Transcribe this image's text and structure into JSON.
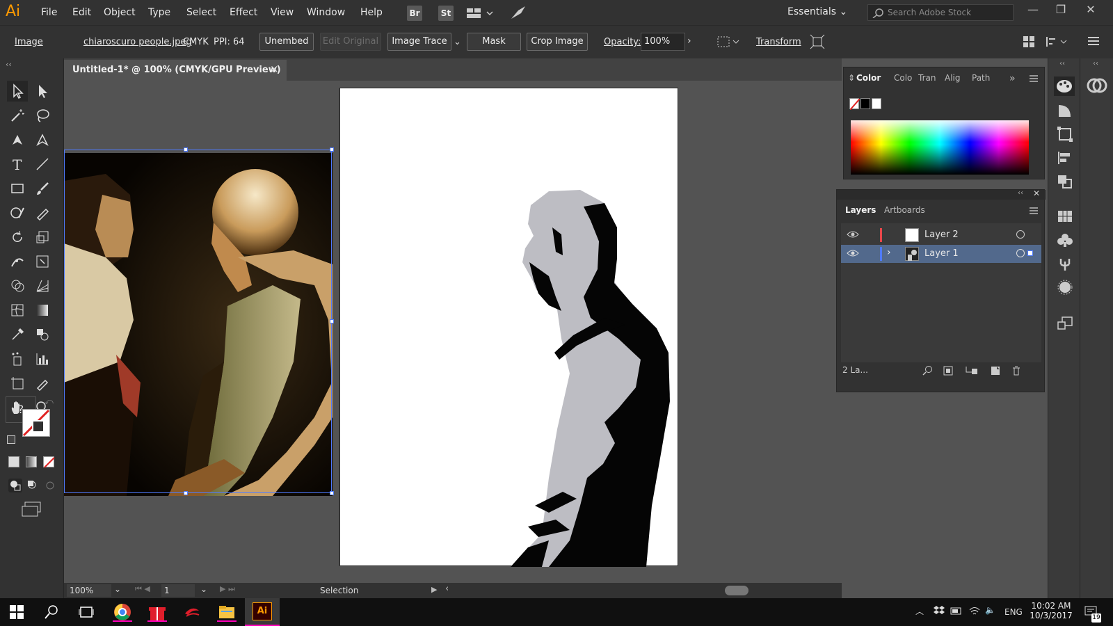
{
  "app": {
    "logo": "Ai"
  },
  "menu": [
    "File",
    "Edit",
    "Object",
    "Type",
    "Select",
    "Effect",
    "View",
    "Window",
    "Help"
  ],
  "bridge_buttons": [
    "Br",
    "St"
  ],
  "workspace": "Essentials",
  "search": {
    "placeholder": "Search Adobe Stock"
  },
  "control_bar": {
    "type_label": "Image",
    "file_name": "chiaroscuro people.jpeg",
    "color_mode": "CMYK",
    "ppi": "PPI: 64",
    "unembed": "Unembed",
    "edit_original": "Edit Original",
    "image_trace": "Image Trace",
    "mask": "Mask",
    "crop_image": "Crop Image",
    "opacity_label": "Opacity:",
    "opacity_value": "100%",
    "transform": "Transform"
  },
  "document": {
    "tab_title": "Untitled-1* @ 100% (CMYK/GPU Preview)",
    "close": "×"
  },
  "status": {
    "zoom": "100%",
    "artboard_num": "1",
    "tool": "Selection"
  },
  "color_panel": {
    "tabs": [
      "Color",
      "Colo",
      "Tran",
      "Alig",
      "Path"
    ],
    "more": "»"
  },
  "layers_panel": {
    "tabs": [
      "Layers",
      "Artboards"
    ],
    "layers": [
      {
        "name": "Layer 2",
        "color": "#e8474b",
        "selected": false
      },
      {
        "name": "Layer 1",
        "color": "#4f7bff",
        "selected": true
      }
    ],
    "count": "2 La..."
  },
  "taskbar": {
    "time": "10:02 AM",
    "date": "10/3/2017",
    "lang": "ENG",
    "notif_count": "19"
  },
  "colors": {
    "ui_dark": "#323232",
    "canvas": "#535353",
    "accent": "#ff9a00",
    "selection": "#4f7bff"
  }
}
